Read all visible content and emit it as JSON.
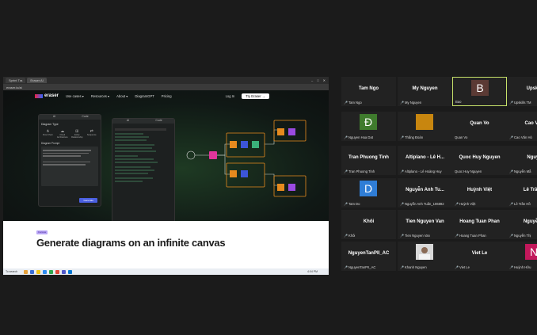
{
  "browser": {
    "tabs": [
      "Sprint Tra",
      "Eraser AI"
    ],
    "url": "eraser.io/ai"
  },
  "site": {
    "brand": "eraser",
    "nav": [
      "Use cases ▾",
      "Resources ▾",
      "About ▾",
      "DiagramGPT",
      "Pricing"
    ],
    "login": "Log In",
    "try": "Try Eraser →",
    "panel_tabs": [
      "AI",
      "Code"
    ],
    "panel_title": "Diagram Type",
    "panel_types": [
      "Flow Chart",
      "Cloud Architecture",
      "Entity Relationship",
      "Sequence"
    ],
    "prompt_label": "Diagram Prompt",
    "generate": "Generate",
    "code_tabs": [
      "AI",
      "Code"
    ],
    "badge": "Canvas",
    "headline": "Generate diagrams on an infinite canvas"
  },
  "taskbar": {
    "search": "To search",
    "clock": "4:04 PM"
  },
  "participants": [
    {
      "name": "Tam Ngo",
      "label": "Tam Ngo",
      "muted": true
    },
    {
      "name": "My Nguyen",
      "label": "My Nguyen",
      "muted": true
    },
    {
      "name": "",
      "label": "Bao",
      "muted": false,
      "avatar": "B",
      "avatar_color": "#5b3a34",
      "selected": true
    },
    {
      "name": "Upskill",
      "label": "Upskills TM",
      "muted": true
    },
    {
      "name": "",
      "label": "Nguyen Hua Dat",
      "muted": true,
      "avatar": "Đ",
      "avatar_color": "#3f7b2d"
    },
    {
      "name": "",
      "label": "Thắng Đoàn",
      "muted": true,
      "avatar": "",
      "avatar_color": "#c8860f"
    },
    {
      "name": "Quan Vo",
      "label": "Quan Vo",
      "muted": false
    },
    {
      "name": "Cao Văn",
      "label": "Cao Văn Hò",
      "muted": true
    },
    {
      "name": "Tran Phuong Tinh",
      "label": "Tran Phuong Tinh",
      "muted": true
    },
    {
      "name": "Altiplano - Lê H...",
      "label": "Altiplano - Lê Hoàng Huy",
      "muted": true
    },
    {
      "name": "Quoc Huy Nguyen",
      "label": "Quoc Huy Nguyen",
      "muted": false
    },
    {
      "name": "Nguyễ",
      "label": "Nguyễn Mẫ",
      "muted": true
    },
    {
      "name": "",
      "label": "Tam Do",
      "muted": true,
      "avatar": "D",
      "avatar_color": "#2f7dd6"
    },
    {
      "name": "Nguyễn Anh Tu...",
      "label": "Nguyễn Anh Tuấn_106892",
      "muted": true
    },
    {
      "name": "Huỳnh Việt",
      "label": "Huỳnh Việt",
      "muted": true
    },
    {
      "name": "Lê Trần H",
      "label": "Lê Trần Hồ",
      "muted": true
    },
    {
      "name": "Khôi",
      "label": "Khôi",
      "muted": true
    },
    {
      "name": "Tien Nguyen Van",
      "label": "Tien Nguyen Van",
      "muted": true
    },
    {
      "name": "Hoang Tuan Phan",
      "label": "Hoang Tuan Phan",
      "muted": true
    },
    {
      "name": "Nguyễn T",
      "label": "Nguyễn Thị",
      "muted": true
    },
    {
      "name": "NguyenTanPII_AC",
      "label": "NguyenTanPII_AC",
      "muted": true
    },
    {
      "name": "",
      "label": "Khanh Nguyen",
      "muted": true,
      "avatar": "photo",
      "avatar_color": "#d8d8d8"
    },
    {
      "name": "Viet Le",
      "label": "Viet Le",
      "muted": true
    },
    {
      "name": "",
      "label": "Huỳnh Hữu",
      "muted": true,
      "avatar": "N",
      "avatar_color": "#c2185b"
    }
  ]
}
